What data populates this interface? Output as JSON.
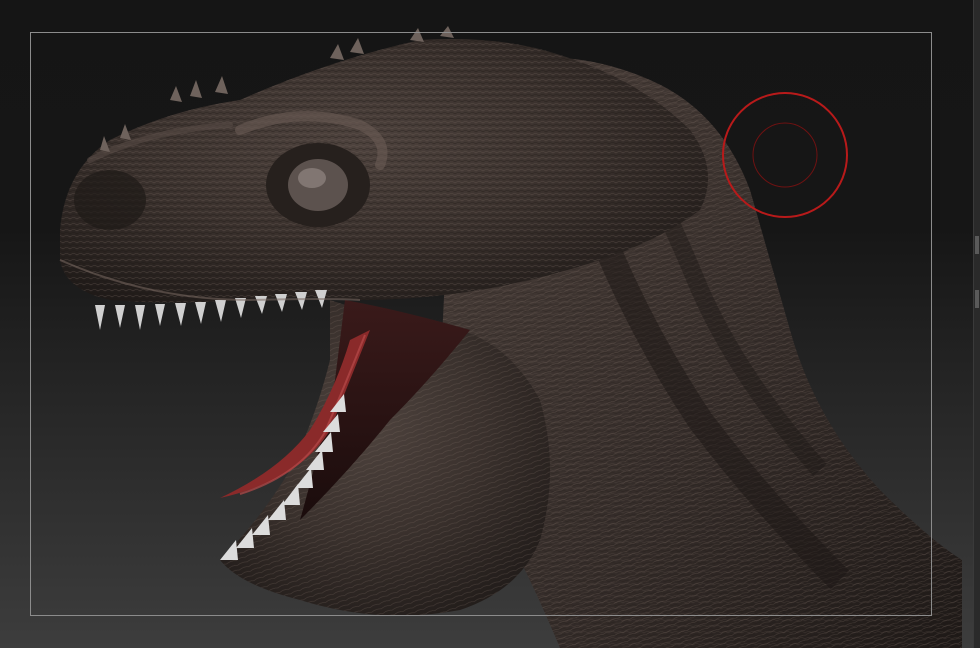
{
  "viewport": {
    "model_name": "",
    "colors": {
      "background_top": "#151515",
      "background_bottom": "#3d3d3d",
      "frame": "#8c8c8c",
      "brush_outer": "#b81a1a",
      "brush_inner": "#6e1212",
      "skin_dark": "#2a2421",
      "skin_mid": "#4a3f3a",
      "skin_light": "#7a6a62",
      "tongue": "#8a2a2a",
      "teeth": "#d8d8d8"
    }
  },
  "cursor": {
    "type": "brush-cursor",
    "icon": "draw-size-circle-icon"
  }
}
